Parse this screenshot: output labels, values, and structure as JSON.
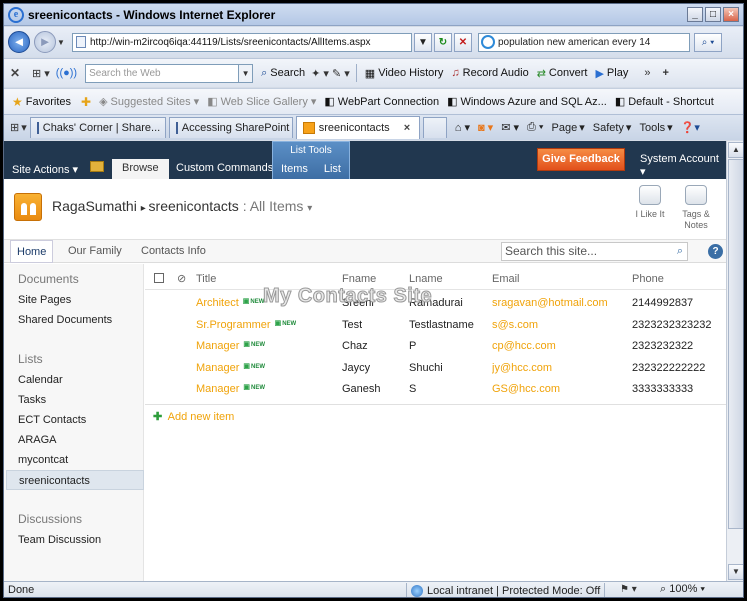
{
  "browser": {
    "title": "sreenicontacts - Windows Internet Explorer",
    "url": "http://win-m2ircoq6iqa:44119/Lists/sreenicontacts/AllItems.aspx",
    "search_query": "population new american every 14",
    "web_search_placeholder": "Search the Web",
    "toolbar": [
      "Search",
      "Video History",
      "Record Audio",
      "Convert",
      "Play"
    ],
    "favorites_label": "Favorites",
    "favorites": [
      "Suggested Sites",
      "Web Slice Gallery",
      "WebPart Connection",
      "Windows Azure and SQL Az...",
      "Default - Shortcut"
    ],
    "tabs": [
      "Chaks' Corner | Share...",
      "Accessing SharePoint ...",
      "sreenicontacts"
    ],
    "commands": [
      "Page",
      "Safety",
      "Tools"
    ],
    "status": "Done",
    "zone": "Local intranet | Protected Mode: Off",
    "zoom": "100%"
  },
  "sharepoint": {
    "ribbon": {
      "site_actions": "Site Actions",
      "browse": "Browse",
      "custom_commands": "Custom Commands",
      "list_tools": "List Tools",
      "items": "Items",
      "list": "List",
      "give_feedback": "Give Feedback",
      "system_account": "System Account"
    },
    "breadcrumb": {
      "site": "RagaSumathi",
      "list": "sreenicontacts",
      "view": "All Items"
    },
    "social": {
      "like": "I Like It",
      "tags_line1": "Tags &",
      "tags_line2": "Notes"
    },
    "topnav": [
      "Home",
      "Our Family",
      "Contacts Info"
    ],
    "search_placeholder": "Search this site...",
    "quicklaunch": {
      "documents_heading": "Documents",
      "documents": [
        "Site Pages",
        "Shared Documents"
      ],
      "lists_heading": "Lists",
      "lists": [
        "Calendar",
        "Tasks",
        "ECT Contacts",
        "ARAGA",
        "mycontcat",
        "sreenicontacts"
      ],
      "discussions_heading": "Discussions",
      "discussions": [
        "Team Discussion"
      ]
    },
    "list": {
      "watermark": "My Contacts Site",
      "columns": [
        "Title",
        "Fname",
        "Lname",
        "Email",
        "Phone"
      ],
      "new_label": "NEW",
      "rows": [
        {
          "title": "Architect",
          "fname": "Sreeni",
          "lname": "Ramadurai",
          "email": "sragavan@hotmail.com",
          "phone": "2144992837"
        },
        {
          "title": "Sr.Programmer",
          "fname": "Test",
          "lname": "Testlastname",
          "email": "s@s.com",
          "phone": "2323232323232"
        },
        {
          "title": "Manager",
          "fname": "Chaz",
          "lname": "P",
          "email": "cp@hcc.com",
          "phone": "2323232322"
        },
        {
          "title": "Manager",
          "fname": "Jaycy",
          "lname": "Shuchi",
          "email": "jy@hcc.com",
          "phone": "232322222222"
        },
        {
          "title": "Manager",
          "fname": "Ganesh",
          "lname": "S",
          "email": "GS@hcc.com",
          "phone": "3333333333"
        }
      ],
      "add_new": "Add new item"
    }
  }
}
